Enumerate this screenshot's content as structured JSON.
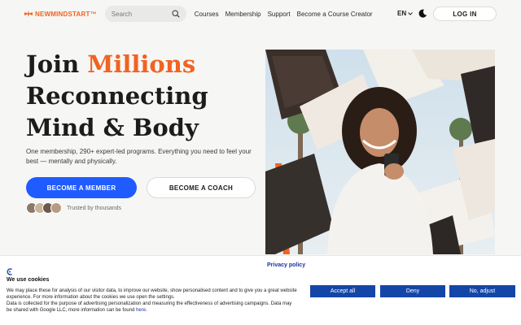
{
  "header": {
    "logo_text": "NEWMINDSTART™",
    "logo_icon": "flower-logo-icon",
    "search_placeholder": "Search",
    "nav_items": [
      "Courses",
      "Membership",
      "Support",
      "Become a Course Creator"
    ],
    "language": "EN",
    "login_label": "LOG IN"
  },
  "hero": {
    "headline_part1": "Join ",
    "headline_accent": "Millions",
    "headline_line2": "Reconnecting",
    "headline_line3": "Mind & Body",
    "subtext": "One membership, 290+ expert-led programs. Everything you need to feel your best — mentally and physically.",
    "primary_cta": "BECOME A MEMBER",
    "secondary_cta": "BECOME A COACH",
    "trust_text": "Trusted by thousands"
  },
  "cookie_banner": {
    "privacy_link": "Privacy policy",
    "title": "We use cookies",
    "text_1": "We may place these for analysis of our visitor data, to improve our website, show personalised content and to give you a great website experience. For more information about the cookies we use open the settings.",
    "text_2": "Data is collected for the purpose of advertising personalization and measuring the effectiveness of advertising campaigns. Data may be shared with Google LLC, more information can be found ",
    "text_link": "here",
    "text_end": ".",
    "accept_label": "Accept all",
    "deny_label": "Deny",
    "adjust_label": "No, adjust"
  },
  "colors": {
    "accent": "#f06322",
    "primary_button": "#1f5bff",
    "cookie_button": "#1446a8"
  }
}
